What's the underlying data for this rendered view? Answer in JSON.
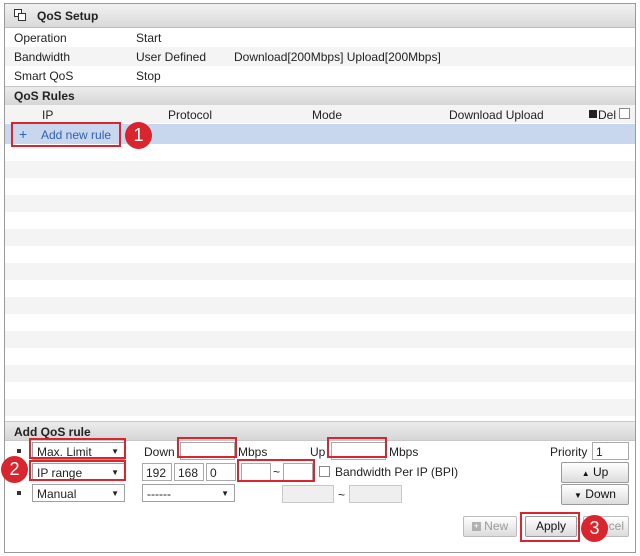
{
  "title": "QoS Setup",
  "status": [
    {
      "label": "Operation",
      "value": "Start"
    },
    {
      "label": "Bandwidth",
      "value": "User Defined",
      "extra": "Download[200Mbps] Upload[200Mbps]"
    },
    {
      "label": "Smart QoS",
      "value": "Stop"
    }
  ],
  "rules": {
    "section_title": "QoS Rules",
    "columns": {
      "ip": "IP",
      "protocol": "Protocol",
      "mode": "Mode",
      "download_upload": "Download Upload",
      "del": "Del"
    },
    "add_rule_icon": "+",
    "add_rule_label": "Add new rule"
  },
  "add_rule": {
    "section_title": "Add QoS rule",
    "limit_select": "Max. Limit",
    "down_label": "Down",
    "down_value": "",
    "mbps_label": "Mbps",
    "up_label": "Up",
    "up_value": "",
    "mbps_label2": "Mbps",
    "priority_label": "Priority",
    "priority_value": "1",
    "ip_select": "IP range",
    "ip1": "192",
    "ip2": "168",
    "ip3": "0",
    "ip4": "",
    "range_sep": "~",
    "ip_end": "",
    "bpi_label": "Bandwidth Per IP (BPI)",
    "up_button": "Up",
    "mode_select": "Manual",
    "protocol_select": "------",
    "port_start": "",
    "port_sep": "~",
    "port_end": "",
    "down_button": "Down"
  },
  "buttons": {
    "new": "New",
    "apply": "Apply",
    "cancel": "ncel"
  },
  "badges": [
    "1",
    "2",
    "3"
  ],
  "icons": {
    "window": "qos-window-icon",
    "bullet": "square-bullet",
    "arrow": "triangle-down",
    "up": "triangle-up"
  },
  "colors": {
    "highlight_row": "#c9d7ee",
    "annotation": "#d9262e",
    "link": "#2f5fb3"
  }
}
